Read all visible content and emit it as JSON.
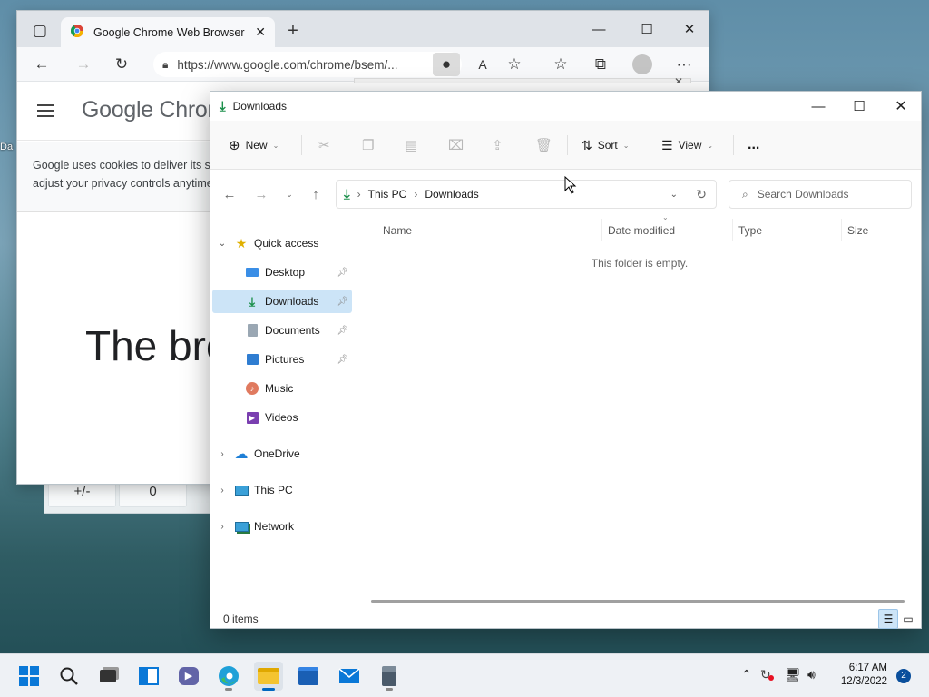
{
  "desktop": {
    "icon_label_fragment": "Da"
  },
  "calculator": {
    "keys": [
      "+/-",
      "0"
    ]
  },
  "browser": {
    "tab_title": "Google Chrome Web Browser",
    "url": "https://www.google.com/chrome/bsem/...",
    "logo_text": "Google Chrom",
    "cookie_line1": "Google uses cookies to deliver its se",
    "cookie_line2": "adjust your privacy controls anytime",
    "hero_text": "The bro"
  },
  "explorer": {
    "title": "Downloads",
    "toolbar": {
      "new": "New",
      "sort": "Sort",
      "view": "View",
      "more": "..."
    },
    "breadcrumb": [
      "This PC",
      "Downloads"
    ],
    "search_placeholder": "Search Downloads",
    "columns": [
      "Name",
      "Date modified",
      "Type",
      "Size"
    ],
    "empty_message": "This folder is empty.",
    "sidebar": {
      "quick_access": "Quick access",
      "pinned": [
        {
          "label": "Desktop",
          "icon": "desktop-folder-icon",
          "pinned": true
        },
        {
          "label": "Downloads",
          "icon": "download-icon",
          "pinned": true,
          "selected": true
        },
        {
          "label": "Documents",
          "icon": "documents-icon",
          "pinned": true
        },
        {
          "label": "Pictures",
          "icon": "pictures-icon",
          "pinned": true
        },
        {
          "label": "Music",
          "icon": "music-icon",
          "pinned": false
        },
        {
          "label": "Videos",
          "icon": "videos-icon",
          "pinned": false
        }
      ],
      "onedrive": "OneDrive",
      "this_pc": "This PC",
      "network": "Network"
    },
    "status": "0 items"
  },
  "taskbar": {
    "time": "6:17 AM",
    "date": "12/3/2022",
    "notification_count": "2",
    "colors": {
      "accent": "#0067c0"
    }
  }
}
